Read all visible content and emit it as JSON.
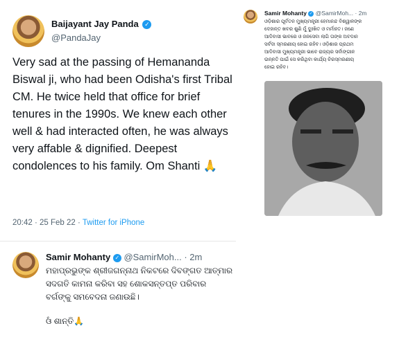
{
  "tweet_main": {
    "name": "Baijayant Jay Panda",
    "handle": "@PandaJay",
    "text": "Very sad at the passing of Hemananda Biswal ji, who had been Odisha's first Tribal CM. He twice held that office for brief tenures in the 1990s. We knew each other well & had interacted often, he was always very affable & dignified. Deepest condolences to his family. Om Shanti 🙏",
    "time": "20:42 · 25 Feb 22 · ",
    "source": "Twitter for iPhone"
  },
  "tweet_right": {
    "name": "Samir Mohanty",
    "handle": "@SamirMoh...",
    "age": "· 2m",
    "text_lines": [
      "ଓଡ଼ିଶାର ପୂର୍ବତନ ମୁଖ୍ୟମନ୍ତ୍ରୀ ହେମାନନ୍ଦ ବିଶ୍ୱାଳଙ୍କ",
      "ଦେହାନ୍ତ ଖବର ଶୁଣି ମୁଁ ଦୁଃଖିତ ଓ ମର୍ମାହତ। ଜଣେ",
      "ଆଦିବାସୀ ଭାବରେ ଓ ଜନସେବା ଲାଗି ତାଙ୍କ ଅବଦାନ",
      "ସର୍ବଦା ସ୍ମରଣୀୟ ହୋଇ ରହିବ। ଓଡ଼ିଶାର ପ୍ରଥମ",
      "ଆଦିବାସୀ ମୁଖ୍ୟମନ୍ତ୍ରୀ ଭାବେ ରାଜ୍ୟର ସର୍ବାଙ୍ଗୀନ",
      "ଉନ୍ନତି ପାଇଁ ସେ କରିଥିବା କାର୍ଯ୍ୟ ଚିରସ୍ମରଣୀୟ",
      "ହୋଇ ରହିବ।"
    ]
  },
  "tweet_bottom": {
    "name": "Samir Mohanty",
    "handle": "@SamirMoh...",
    "age": "· 2m",
    "text_lines": [
      "ମହାପ୍ରଭୁଙ୍କ ଶ୍ରୀଜଗନ୍ନାଥ ନିକଟରେ ଦିବଙ୍ଗତ ଆତ୍ମାର",
      "ସଦଗତି କାମନା କରିବା ସହ ଶୋକସନ୍ତପ୍ତ ପରିବାର",
      "ବର୍ଗଙ୍କୁ ସମବେଦନା ଜଣାଉଛି।"
    ],
    "sign_off": "ଓଁ ଶାନ୍ତି🙏"
  },
  "icons": {
    "verified": "verified-badge-icon",
    "pray": "folded-hands-icon"
  },
  "colors": {
    "link": "#1d9bf0",
    "secondary": "#536471",
    "text": "#0f1419"
  }
}
